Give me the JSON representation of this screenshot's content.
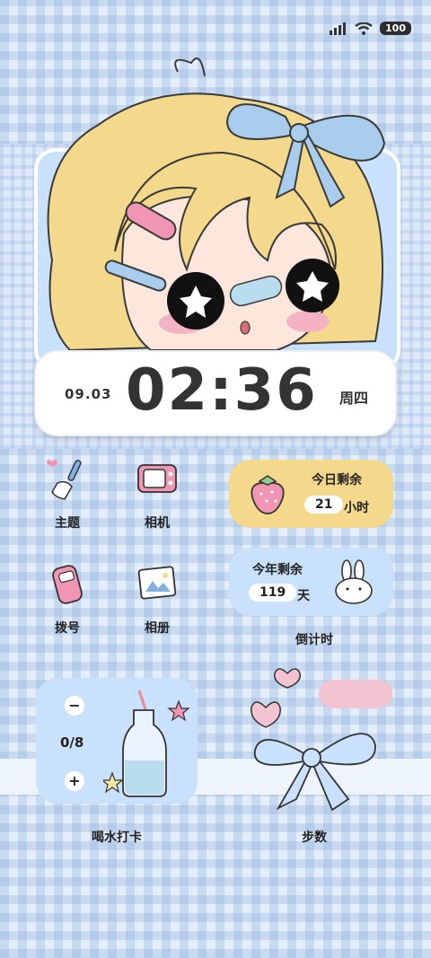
{
  "status": {
    "battery": "100"
  },
  "clock": {
    "date": "09.03",
    "time": "02:36",
    "weekday": "周四"
  },
  "apps": [
    {
      "label": "主题",
      "icon": "broom-icon"
    },
    {
      "label": "相机",
      "icon": "tv-camera-icon"
    },
    {
      "label": "拨号",
      "icon": "phone-icon"
    },
    {
      "label": "相册",
      "icon": "photo-icon"
    }
  ],
  "today_widget": {
    "title": "今日剩余",
    "value": "21",
    "unit": "小时"
  },
  "year_widget": {
    "title": "今年剩余",
    "value": "119",
    "unit": "天"
  },
  "countdown_label": "倒计时",
  "water": {
    "minus": "−",
    "count": "0/8",
    "plus": "+",
    "label": "喝水打卡"
  },
  "steps_label": "步数",
  "colors": {
    "yellow": "#f4d98c",
    "blue": "#c9e1fa",
    "pink": "#f2c3d0"
  }
}
